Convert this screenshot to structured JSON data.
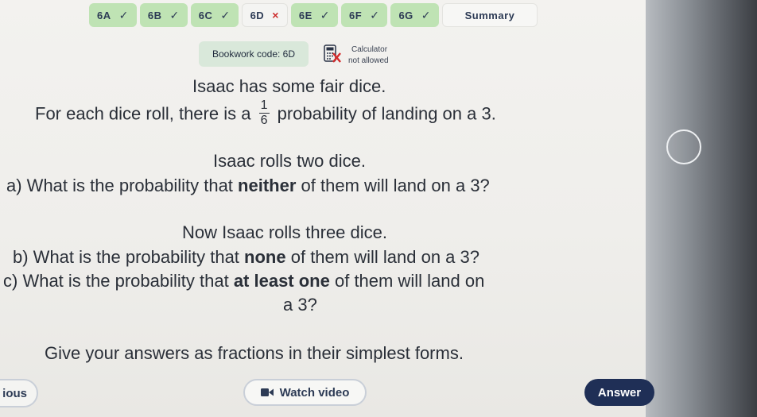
{
  "tabs": [
    {
      "label": "6A",
      "mark": "✓",
      "state": "done"
    },
    {
      "label": "6B",
      "mark": "✓",
      "state": "done"
    },
    {
      "label": "6C",
      "mark": "✓",
      "state": "done"
    },
    {
      "label": "6D",
      "mark": "×",
      "state": "wrong"
    },
    {
      "label": "6E",
      "mark": "✓",
      "state": "done"
    },
    {
      "label": "6F",
      "mark": "✓",
      "state": "done"
    },
    {
      "label": "6G",
      "mark": "✓",
      "state": "done"
    },
    {
      "label": "Summary",
      "mark": "",
      "state": "summary"
    }
  ],
  "bookwork": {
    "label": "Bookwork code: 6D"
  },
  "calculator": {
    "line1": "Calculator",
    "line2": "not allowed",
    "icon": "calculator-crossed-icon"
  },
  "question": {
    "line1": "Isaac has some fair dice.",
    "line2_pre": "For each dice roll, there is a",
    "fraction_num": "1",
    "fraction_den": "6",
    "line2_post": "probability of landing on a 3.",
    "line3": "Isaac rolls two dice.",
    "line4_pre": "a) What is the probability that",
    "line4_bold": "neither",
    "line4_post": "of them will land on a 3?",
    "line5": "Now Isaac rolls three dice.",
    "line6_pre": "b) What is the probability that",
    "line6_bold": "none",
    "line6_post": "of them will land on a 3?",
    "line7_pre": "c) What is the probability that",
    "line7_bold": "at least one",
    "line7_post": "of them will land on",
    "line8": "a 3?",
    "line9": "Give your answers as fractions in their simplest forms."
  },
  "buttons": {
    "previous": "ious",
    "watch_video": "Watch video",
    "watch_video_icon": "video-icon",
    "answer": "Answer"
  },
  "colors": {
    "tab_done": "#bfe3b4",
    "bookwork_bg": "#d9e8da",
    "answer_bg": "#1f2f56",
    "wrong_mark": "#cc2a2a"
  }
}
